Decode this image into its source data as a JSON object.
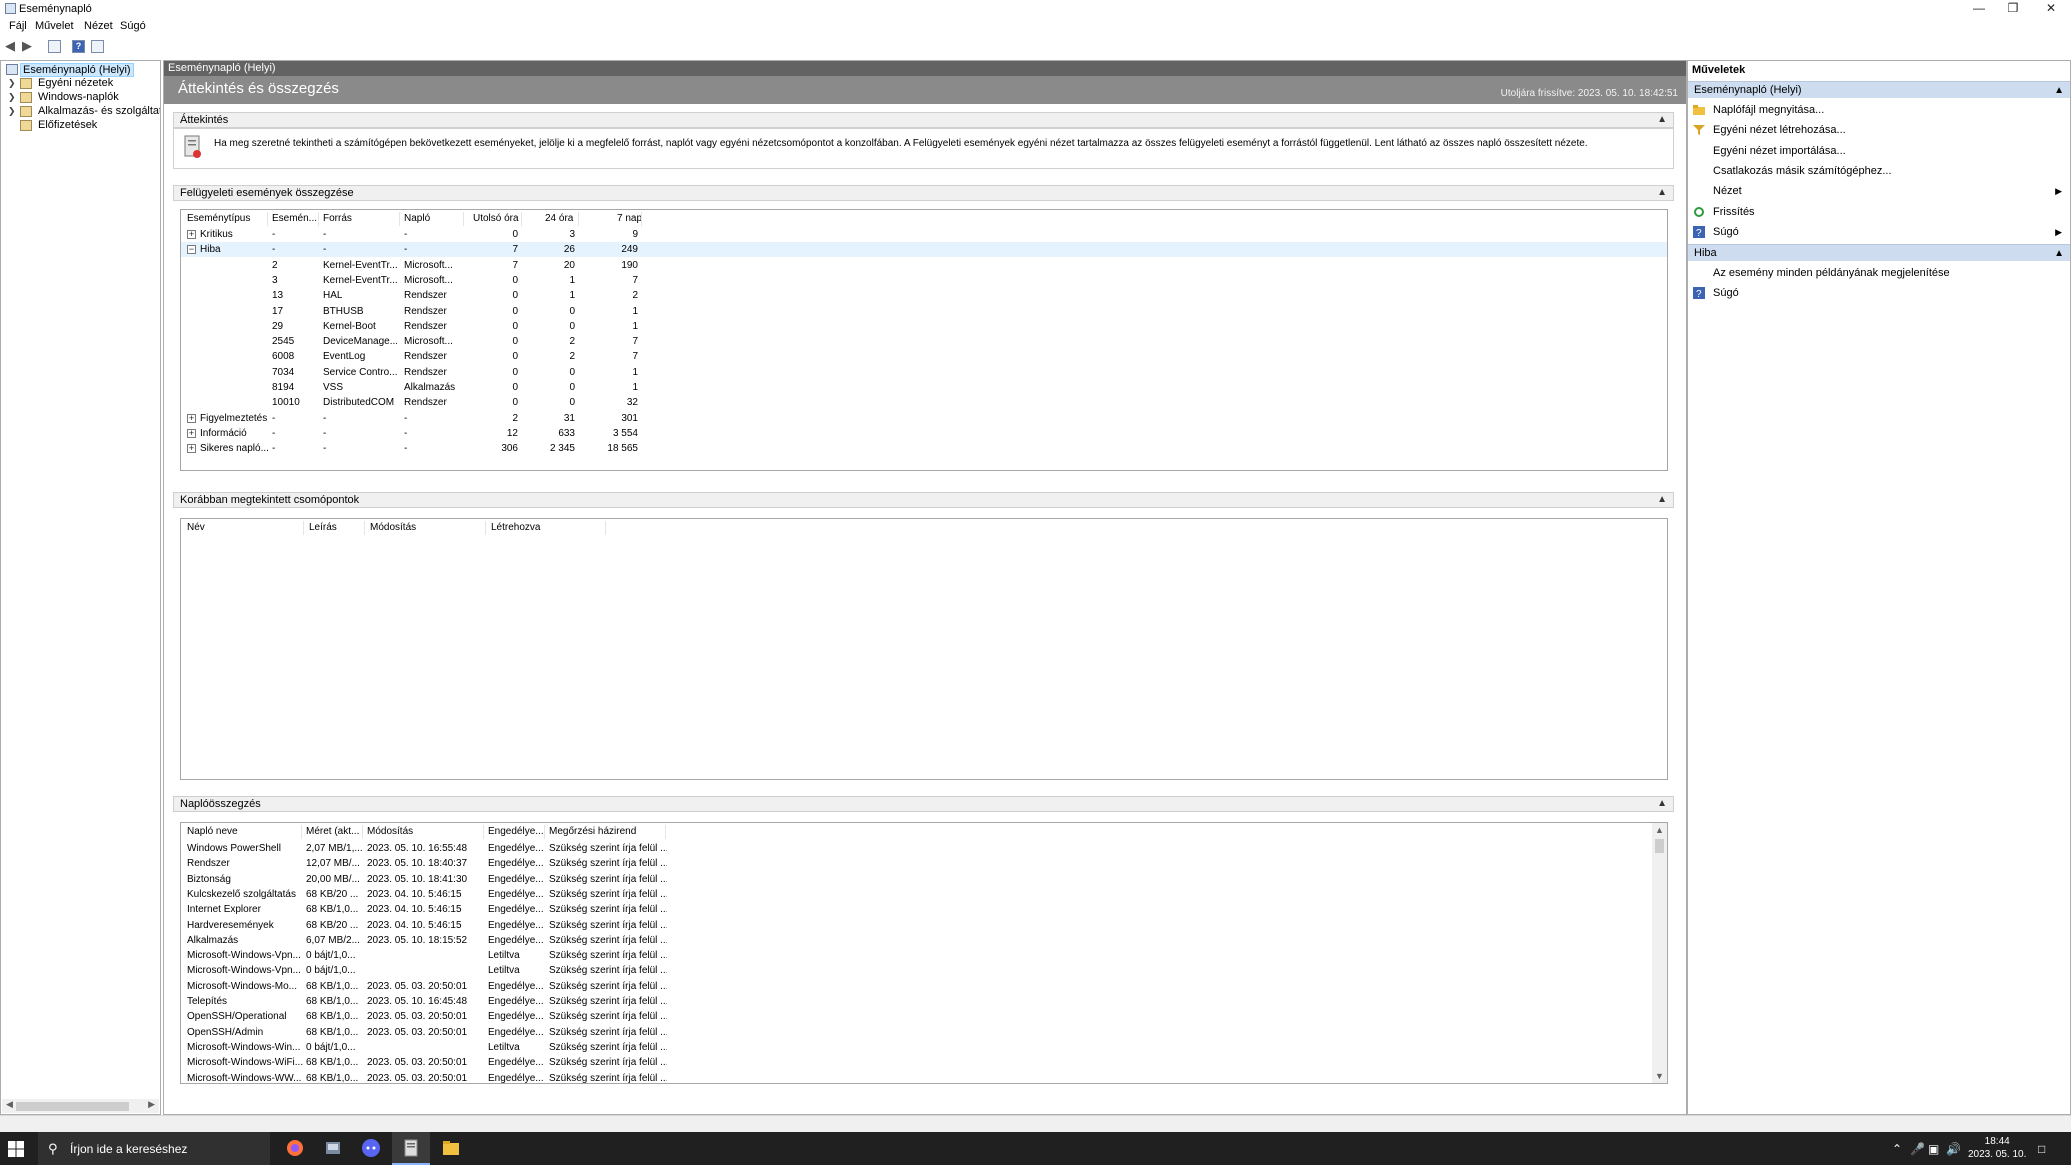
{
  "window": {
    "title": "Eseménynapló",
    "min": "—",
    "max": "❐",
    "close": "✕"
  },
  "menu": [
    "Fájl",
    "Művelet",
    "Nézet",
    "Súgó"
  ],
  "tree": {
    "items": [
      {
        "label": "Eseménynapló (Helyi)"
      },
      {
        "label": "Egyéni nézetek"
      },
      {
        "label": "Windows-naplók"
      },
      {
        "label": "Alkalmazás- és szolgáltatásn"
      },
      {
        "label": "Előfizetések"
      }
    ]
  },
  "center": {
    "header": "Eseménynapló (Helyi)",
    "banner_title": "Áttekintés és összegzés",
    "last_refresh": "Utoljára frissítve: 2023. 05. 10. 18:42:51",
    "overview": {
      "title": "Áttekintés",
      "text": "Ha meg szeretné tekintheti a számítógépen bekövetkezett eseményeket, jelölje ki a megfelelő forrást, naplót vagy egyéni nézetcsomópontot a konzolfában. A Felügyeleti események egyéni nézet tartalmazza az összes felügyeleti eseményt a forrástól függetlenül. Lent látható az összes napló összesített nézete."
    },
    "summary": {
      "title": "Felügyeleti események összegzése",
      "columns": [
        "Eseménytípus",
        "Esemén...",
        "Forrás",
        "Napló",
        "Utolsó óra",
        "24 óra",
        "7 nap"
      ],
      "rows": [
        {
          "type": "Kritikus",
          "id": "-",
          "source": "-",
          "log": "-",
          "h": "0",
          "d": "3",
          "w": "9",
          "expand": "+"
        },
        {
          "type": "Hiba",
          "id": "-",
          "source": "-",
          "log": "-",
          "h": "7",
          "d": "26",
          "w": "249",
          "expand": "−"
        },
        {
          "type": "",
          "id": "2",
          "source": "Kernel-EventTr...",
          "log": "Microsoft...",
          "h": "7",
          "d": "20",
          "w": "190"
        },
        {
          "type": "",
          "id": "3",
          "source": "Kernel-EventTr...",
          "log": "Microsoft...",
          "h": "0",
          "d": "1",
          "w": "7"
        },
        {
          "type": "",
          "id": "13",
          "source": "HAL",
          "log": "Rendszer",
          "h": "0",
          "d": "1",
          "w": "2"
        },
        {
          "type": "",
          "id": "17",
          "source": "BTHUSB",
          "log": "Rendszer",
          "h": "0",
          "d": "0",
          "w": "1"
        },
        {
          "type": "",
          "id": "29",
          "source": "Kernel-Boot",
          "log": "Rendszer",
          "h": "0",
          "d": "0",
          "w": "1"
        },
        {
          "type": "",
          "id": "2545",
          "source": "DeviceManage...",
          "log": "Microsoft...",
          "h": "0",
          "d": "2",
          "w": "7"
        },
        {
          "type": "",
          "id": "6008",
          "source": "EventLog",
          "log": "Rendszer",
          "h": "0",
          "d": "2",
          "w": "7"
        },
        {
          "type": "",
          "id": "7034",
          "source": "Service Contro...",
          "log": "Rendszer",
          "h": "0",
          "d": "0",
          "w": "1"
        },
        {
          "type": "",
          "id": "8194",
          "source": "VSS",
          "log": "Alkalmazás",
          "h": "0",
          "d": "0",
          "w": "1"
        },
        {
          "type": "",
          "id": "10010",
          "source": "DistributedCOM",
          "log": "Rendszer",
          "h": "0",
          "d": "0",
          "w": "32"
        },
        {
          "type": "Figyelmeztetés",
          "id": "-",
          "source": "-",
          "log": "-",
          "h": "2",
          "d": "31",
          "w": "301",
          "expand": "+"
        },
        {
          "type": "Információ",
          "id": "-",
          "source": "-",
          "log": "-",
          "h": "12",
          "d": "633",
          "w": "3 554",
          "expand": "+"
        },
        {
          "type": "Sikeres napló...",
          "id": "-",
          "source": "-",
          "log": "-",
          "h": "306",
          "d": "2 345",
          "w": "18 565",
          "expand": "+"
        }
      ]
    },
    "recent": {
      "title": "Korábban megtekintett csomópontok",
      "columns": [
        "Név",
        "Leírás",
        "Módosítás",
        "Létrehozva"
      ]
    },
    "logsummary": {
      "title": "Naplóösszegzés",
      "columns": [
        "Napló neve",
        "Méret (akt...",
        "Módosítás",
        "Engedélye...",
        "Megőrzési házirend"
      ],
      "rows": [
        [
          "Windows PowerShell",
          "2,07 MB/1,...",
          "2023. 05. 10. 16:55:48",
          "Engedélye...",
          "Szükség szerint írja felül ..."
        ],
        [
          "Rendszer",
          "12,07 MB/...",
          "2023. 05. 10. 18:40:37",
          "Engedélye...",
          "Szükség szerint írja felül ..."
        ],
        [
          "Biztonság",
          "20,00 MB/...",
          "2023. 05. 10. 18:41:30",
          "Engedélye...",
          "Szükség szerint írja felül ..."
        ],
        [
          "Kulcskezelő szolgáltatás",
          "68 KB/20 ...",
          "2023. 04. 10. 5:46:15",
          "Engedélye...",
          "Szükség szerint írja felül ..."
        ],
        [
          "Internet Explorer",
          "68 KB/1,0...",
          "2023. 04. 10. 5:46:15",
          "Engedélye...",
          "Szükség szerint írja felül ..."
        ],
        [
          "Hardveresemények",
          "68 KB/20 ...",
          "2023. 04. 10. 5:46:15",
          "Engedélye...",
          "Szükség szerint írja felül ..."
        ],
        [
          "Alkalmazás",
          "6,07 MB/2...",
          "2023. 05. 10. 18:15:52",
          "Engedélye...",
          "Szükség szerint írja felül ..."
        ],
        [
          "Microsoft-Windows-Vpn...",
          "0 bájt/1,0...",
          "",
          "Letiltva",
          "Szükség szerint írja felül ..."
        ],
        [
          "Microsoft-Windows-Vpn...",
          "0 bájt/1,0...",
          "",
          "Letiltva",
          "Szükség szerint írja felül ..."
        ],
        [
          "Microsoft-Windows-Mo...",
          "68 KB/1,0...",
          "2023. 05. 03. 20:50:01",
          "Engedélye...",
          "Szükség szerint írja felül ..."
        ],
        [
          "Telepítés",
          "68 KB/1,0...",
          "2023. 05. 10. 16:45:48",
          "Engedélye...",
          "Szükség szerint írja felül ..."
        ],
        [
          "OpenSSH/Operational",
          "68 KB/1,0...",
          "2023. 05. 03. 20:50:01",
          "Engedélye...",
          "Szükség szerint írja felül ..."
        ],
        [
          "OpenSSH/Admin",
          "68 KB/1,0...",
          "2023. 05. 03. 20:50:01",
          "Engedélye...",
          "Szükség szerint írja felül ..."
        ],
        [
          "Microsoft-Windows-Win...",
          "0 bájt/1,0...",
          "",
          "Letiltva",
          "Szükség szerint írja felül ..."
        ],
        [
          "Microsoft-Windows-WiFi...",
          "68 KB/1,0...",
          "2023. 05. 03. 20:50:01",
          "Engedélye...",
          "Szükség szerint írja felül ..."
        ],
        [
          "Microsoft-Windows-WW...",
          "68 KB/1,0...",
          "2023. 05. 03. 20:50:01",
          "Engedélye...",
          "Szükség szerint írja felül ..."
        ]
      ]
    }
  },
  "actions": {
    "title": "Műveletek",
    "group1": "Eseménynapló (Helyi)",
    "items1": [
      {
        "label": "Naplófájl megnyitása...",
        "icon": "folder-icon"
      },
      {
        "label": "Egyéni nézet létrehozása...",
        "icon": "filter-icon"
      },
      {
        "label": "Egyéni nézet importálása...",
        "icon": ""
      },
      {
        "label": "Csatlakozás másik számítógéphez...",
        "icon": ""
      },
      {
        "label": "Nézet",
        "icon": "",
        "sub": "▶"
      },
      {
        "label": "Frissítés",
        "icon": "refresh-icon"
      },
      {
        "label": "Súgó",
        "icon": "help-icon",
        "sub": "▶"
      }
    ],
    "group2": "Hiba",
    "items2": [
      {
        "label": "Az esemény minden példányának megjelenítése",
        "icon": ""
      },
      {
        "label": "Súgó",
        "icon": "help-icon"
      }
    ]
  },
  "taskbar": {
    "search_placeholder": "Írjon ide a kereséshez",
    "time": "18:44",
    "date": "2023. 05. 10."
  }
}
